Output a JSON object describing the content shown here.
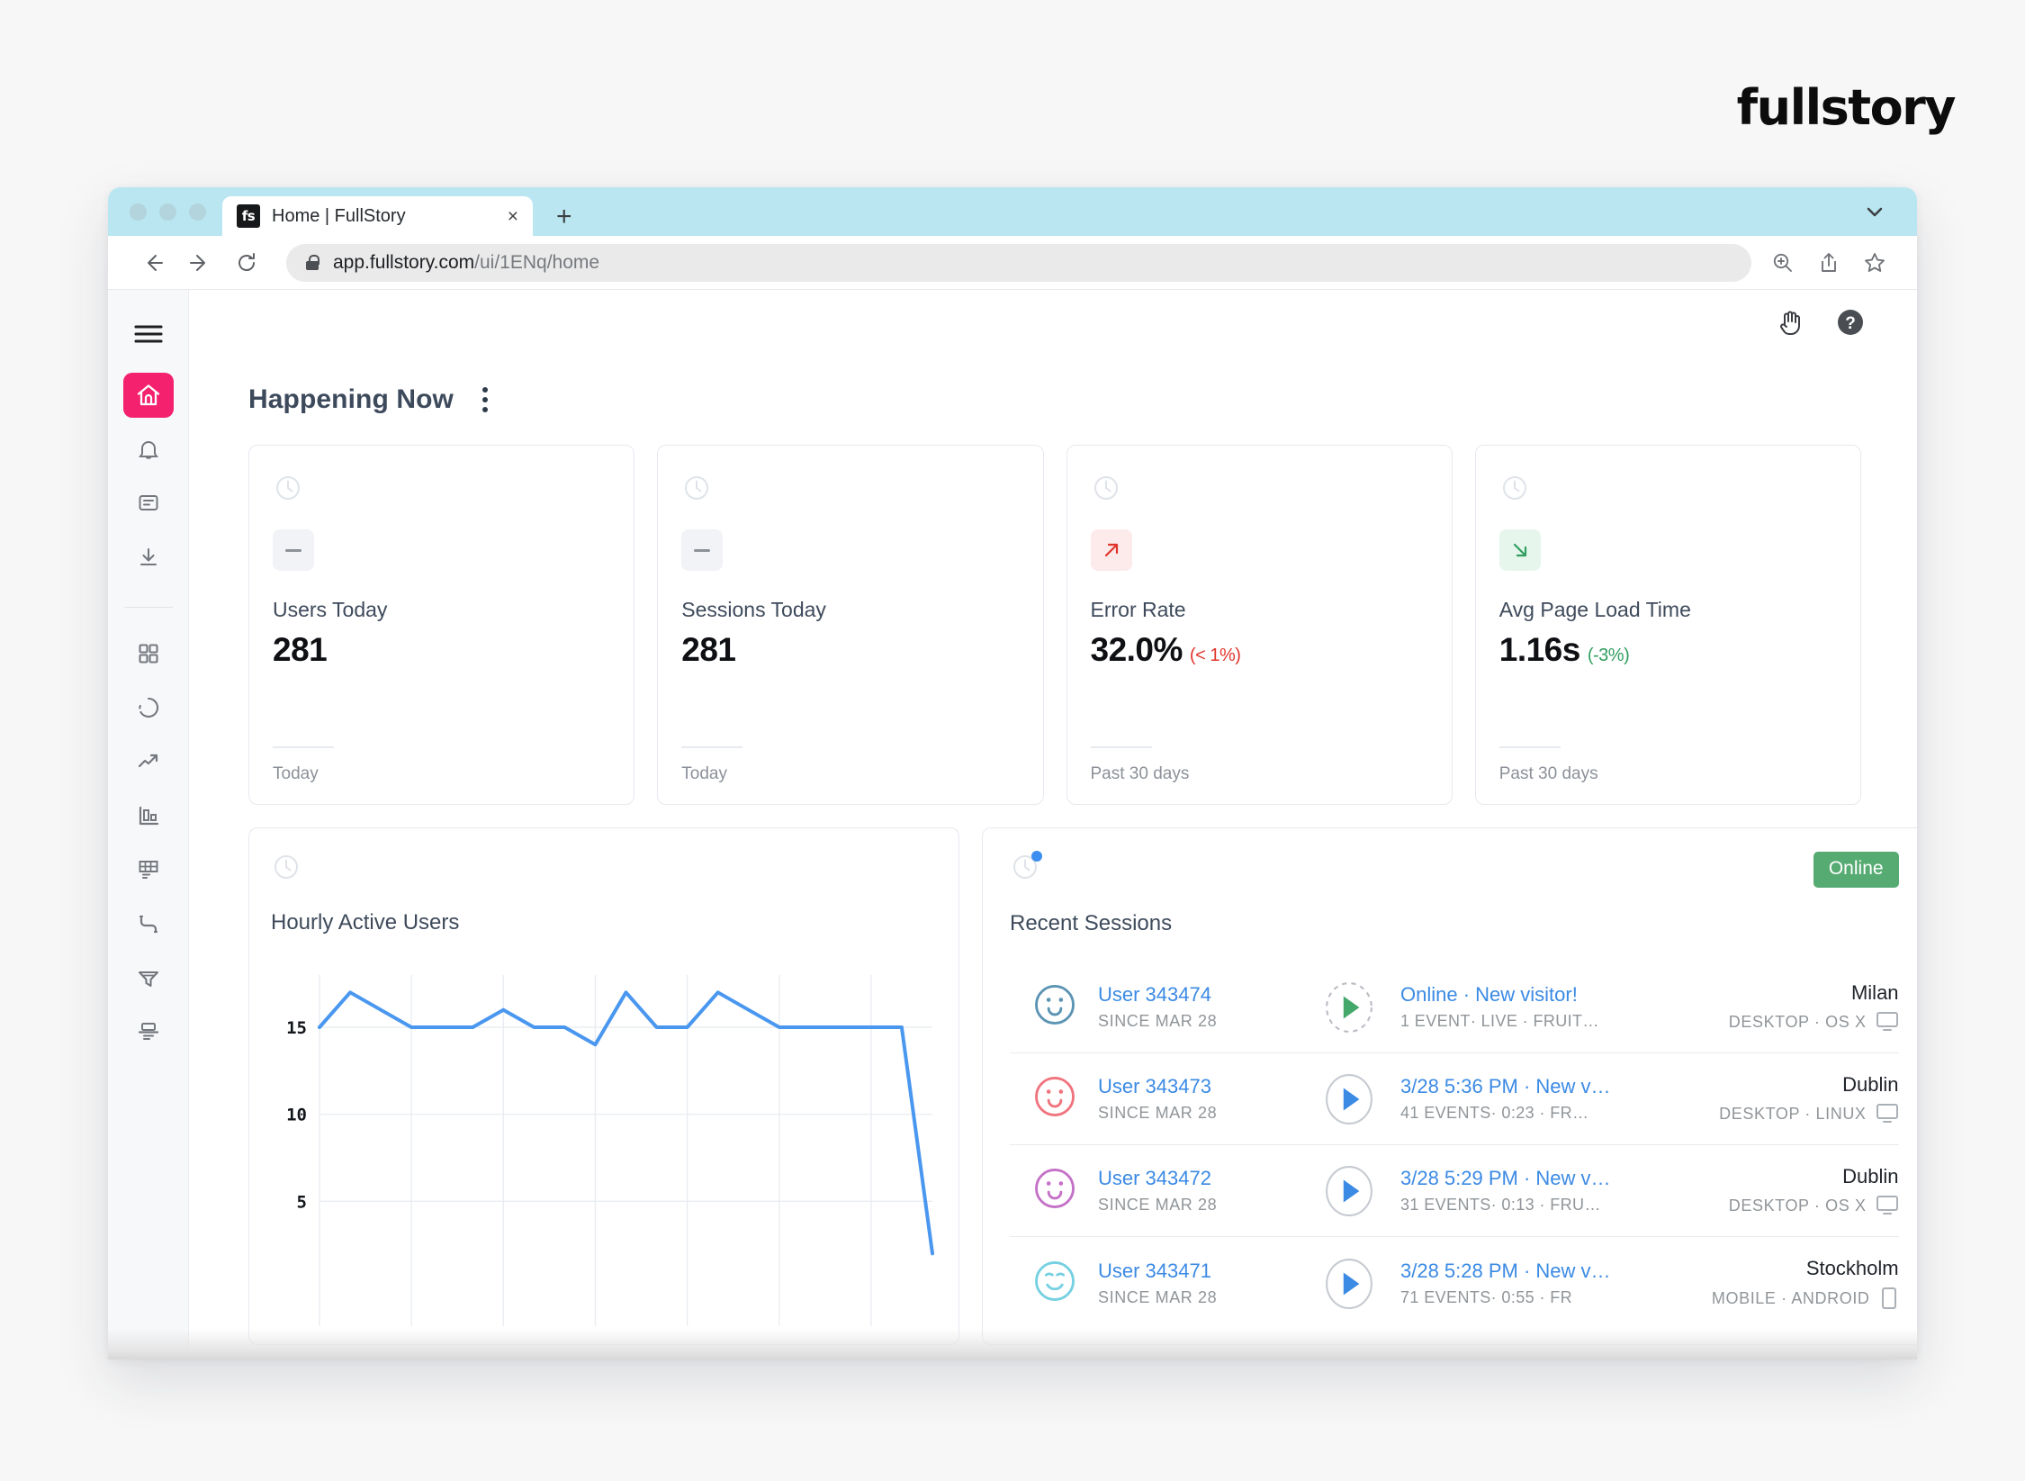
{
  "brand": {
    "logo_text": "fullstory"
  },
  "browser": {
    "tab": {
      "favicon_text": "fs",
      "title": "Home | FullStory",
      "close_label": "×"
    },
    "new_tab_label": "+",
    "tabstrip_chevron": "⌄",
    "nav": {
      "back": "←",
      "forward": "→",
      "reload": "↻"
    },
    "url_main": "app.fullstory.com",
    "url_path": "/ui/1ENq/home",
    "omni_icons": [
      "zoom-in-icon",
      "share-icon",
      "bookmark-star-icon"
    ]
  },
  "sidebar": {
    "items": [
      {
        "name": "menu-hamburger",
        "active": false
      },
      {
        "name": "home",
        "active": true
      },
      {
        "name": "notifications-bell",
        "active": false
      },
      {
        "name": "notes",
        "active": false
      },
      {
        "name": "downloads",
        "active": false
      },
      {
        "name": "dashboards-grid",
        "active": false
      },
      {
        "name": "segments-pie",
        "active": false
      },
      {
        "name": "trends",
        "active": false
      },
      {
        "name": "metrics-bar",
        "active": false
      },
      {
        "name": "heatmaps",
        "active": false
      },
      {
        "name": "journeys",
        "active": false
      },
      {
        "name": "funnels",
        "active": false
      },
      {
        "name": "page-insights",
        "active": false
      }
    ]
  },
  "topbar": {
    "icons": [
      "hand-grab-icon",
      "help-circle-icon"
    ]
  },
  "happening_now": {
    "title": "Happening Now",
    "cards": [
      {
        "label": "Users Today",
        "value": "281",
        "delta": "",
        "delta_dir": "flat",
        "footer": "Today"
      },
      {
        "label": "Sessions Today",
        "value": "281",
        "delta": "",
        "delta_dir": "flat",
        "footer": "Today"
      },
      {
        "label": "Error Rate",
        "value": "32.0%",
        "delta": "(< 1%)",
        "delta_dir": "up",
        "footer": "Past 30 days"
      },
      {
        "label": "Avg Page Load Time",
        "value": "1.16s",
        "delta": "(-3%)",
        "delta_dir": "down",
        "footer": "Past 30 days"
      }
    ]
  },
  "chart_panel": {
    "title": "Hourly Active Users"
  },
  "chart_data": {
    "type": "line",
    "title": "Hourly Active Users",
    "xlabel": "",
    "ylabel": "",
    "ylim": [
      0,
      18
    ],
    "yticks": [
      5,
      10,
      15
    ],
    "grid": true,
    "legend": false,
    "line_color": "#4a97ef",
    "x": [
      0,
      1,
      2,
      3,
      4,
      5,
      6,
      7,
      8,
      9,
      10,
      11,
      12,
      13,
      14,
      15,
      16,
      17,
      18,
      19,
      20
    ],
    "values": [
      15,
      17,
      16,
      15,
      15,
      15,
      16,
      15,
      15,
      14,
      17,
      15,
      15,
      17,
      16,
      15,
      15,
      15,
      15,
      15,
      2
    ]
  },
  "sessions_panel": {
    "title": "Recent Sessions",
    "badge": "Online",
    "rows": [
      {
        "avatar_color": "#5b94b3",
        "avatar_style": "smile",
        "user": "User 343474",
        "since": "SINCE MAR 28",
        "play_style": "live",
        "play_color": "#44a86b",
        "title": "Online · New visitor!",
        "sub": "1 EVENT· LIVE · FRUIT…",
        "city": "Milan",
        "device": "DESKTOP · OS X",
        "device_icon": "desktop-icon"
      },
      {
        "avatar_color": "#f0747e",
        "avatar_style": "smile",
        "user": "User 343473",
        "since": "SINCE MAR 28",
        "play_style": "solid",
        "play_color": "#3b8ae4",
        "title": "3/28 5:36 PM · New v…",
        "sub": "41 EVENTS· 0:23 · FR…",
        "city": "Dublin",
        "device": "DESKTOP · LINUX",
        "device_icon": "desktop-icon"
      },
      {
        "avatar_color": "#c471c7",
        "avatar_style": "smile",
        "user": "User 343472",
        "since": "SINCE MAR 28",
        "play_style": "solid",
        "play_color": "#3b8ae4",
        "title": "3/28 5:29 PM · New v…",
        "sub": "31 EVENTS· 0:13 · FRU…",
        "city": "Dublin",
        "device": "DESKTOP · OS X",
        "device_icon": "desktop-icon"
      },
      {
        "avatar_color": "#75d0e2",
        "avatar_style": "grin",
        "user": "User 343471",
        "since": "SINCE MAR 28",
        "play_style": "solid",
        "play_color": "#3b8ae4",
        "title": "3/28 5:28 PM · New v…",
        "sub": "71 EVENTS· 0:55 · FR",
        "city": "Stockholm",
        "device": "MOBILE · ANDROID",
        "device_icon": "mobile-icon"
      }
    ]
  },
  "colors": {
    "accent_pink": "#f4216e",
    "link_blue": "#3b8ae4",
    "chart_blue": "#4a97ef",
    "online_green": "#56ab72",
    "error_red": "#e0352b",
    "success_green": "#2f9e5f",
    "tabstrip_cyan": "#b9e6f0"
  }
}
